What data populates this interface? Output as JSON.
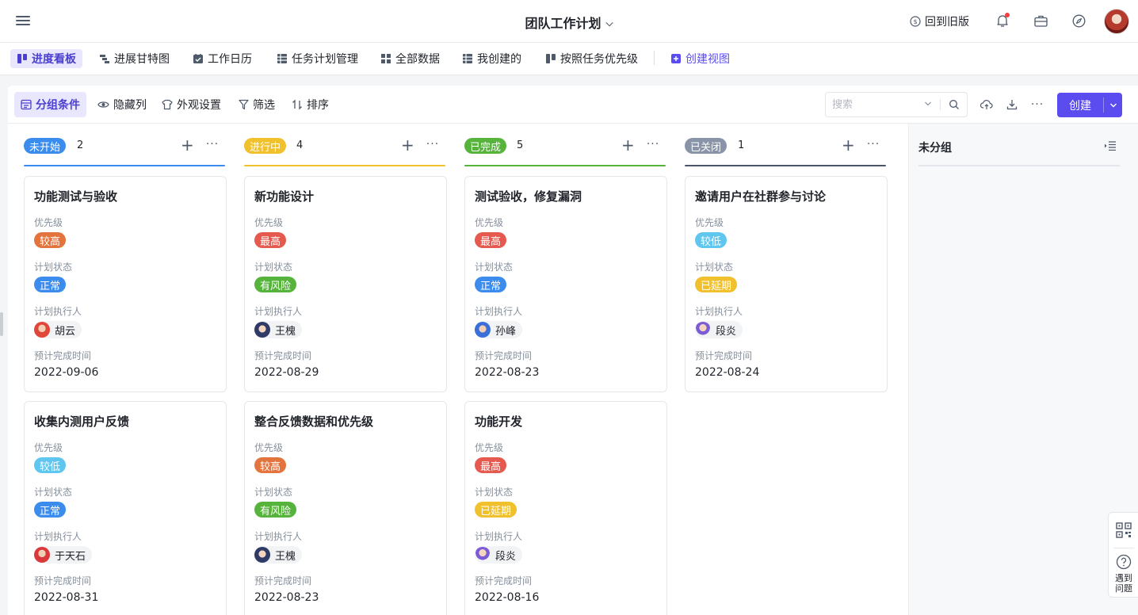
{
  "header": {
    "title": "团队工作计划",
    "old_version": "回到旧版"
  },
  "views": [
    {
      "label": "进度看板",
      "icon": "kanban-icon"
    },
    {
      "label": "进展甘特图",
      "icon": "gantt-icon"
    },
    {
      "label": "工作日历",
      "icon": "calendar-icon"
    },
    {
      "label": "任务计划管理",
      "icon": "table-icon"
    },
    {
      "label": "全部数据",
      "icon": "grid-icon"
    },
    {
      "label": "我创建的",
      "icon": "table-icon"
    },
    {
      "label": "按照任务优先级",
      "icon": "kanban-icon"
    },
    {
      "label": "创建视图",
      "icon": "plus-square-icon"
    }
  ],
  "toolbar": {
    "group": "分组条件",
    "hide_columns": "隐藏列",
    "appearance": "外观设置",
    "filter": "筛选",
    "sort": "排序",
    "search_placeholder": "搜索",
    "create": "创建"
  },
  "labels": {
    "priority": "优先级",
    "plan_status": "计划状态",
    "assignee": "计划执行人",
    "due": "预计完成时间"
  },
  "colors": {
    "accent": "#5b4cf0",
    "not_started": "#3b8ced",
    "in_progress": "#f0c12c",
    "done": "#56b33b",
    "closed": "#8994a8",
    "tag_high": "#e3743d",
    "tag_highest": "#e5594f",
    "tag_low": "#5ec6ef",
    "tag_normal": "#3b8ced",
    "tag_risk": "#56b33b",
    "tag_delayed": "#f0c12c"
  },
  "columns": [
    {
      "status": "未开始",
      "count": "2",
      "cards": [
        {
          "title": "功能测试与验收",
          "priority": "较高",
          "plan_status": "正常",
          "assignee": "胡云",
          "due": "2022-09-06"
        },
        {
          "title": "收集内测用户反馈",
          "priority": "较低",
          "plan_status": "正常",
          "assignee": "于天石",
          "due": "2022-08-31"
        }
      ]
    },
    {
      "status": "进行中",
      "count": "4",
      "cards": [
        {
          "title": "新功能设计",
          "priority": "最高",
          "plan_status": "有风险",
          "assignee": "王槐",
          "due": "2022-08-29"
        },
        {
          "title": "整合反馈数据和优先级",
          "priority": "较高",
          "plan_status": "有风险",
          "assignee": "王槐",
          "due": "2022-08-23"
        }
      ]
    },
    {
      "status": "已完成",
      "count": "5",
      "cards": [
        {
          "title": "测试验收，修复漏洞",
          "priority": "最高",
          "plan_status": "正常",
          "assignee": "孙峰",
          "due": "2022-08-23"
        },
        {
          "title": "功能开发",
          "priority": "最高",
          "plan_status": "已延期",
          "assignee": "段炎",
          "due": "2022-08-16"
        }
      ]
    },
    {
      "status": "已关闭",
      "count": "1",
      "cards": [
        {
          "title": "邀请用户在社群参与讨论",
          "priority": "较低",
          "plan_status": "已延期",
          "assignee": "段炎",
          "due": "2022-08-24"
        }
      ]
    }
  ],
  "uncategorized": "未分组",
  "help": "遇到问题"
}
